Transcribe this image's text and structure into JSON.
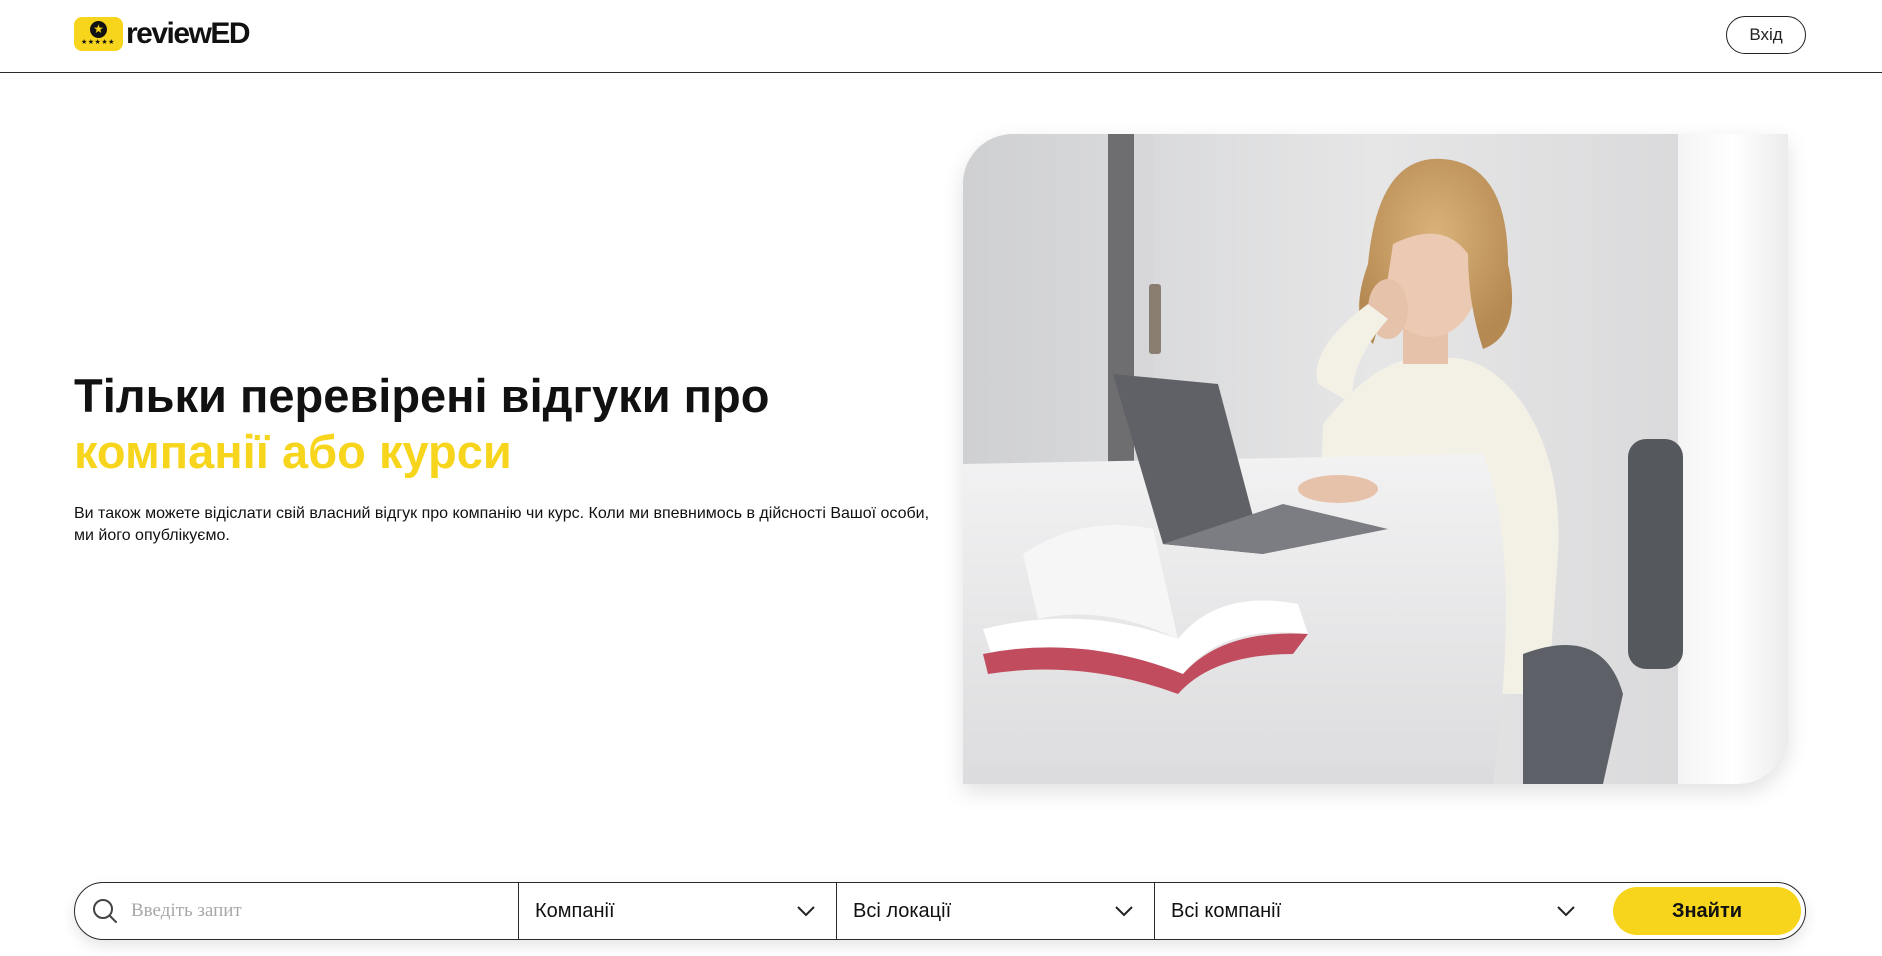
{
  "header": {
    "logo_text": "reviewED",
    "login_label": "Вхід"
  },
  "hero": {
    "title_line1": "Тільки перевірені відгуки про",
    "title_line2": "компанії або курси",
    "description": "Ви також можете відіслати свій власний відгук про компанію чи курс. Коли ми впевнимось в дійсності Вашої особи, ми його опублікуємо."
  },
  "search": {
    "placeholder": "Введіть запит",
    "type_select": "Компанії",
    "location_select": "Всі локації",
    "company_select": "Всі компанії",
    "submit_label": "Знайти"
  },
  "colors": {
    "accent": "#f7d51d",
    "text": "#111111"
  },
  "icons": [
    "logo-star-icon",
    "search-icon",
    "chevron-down-icon"
  ]
}
